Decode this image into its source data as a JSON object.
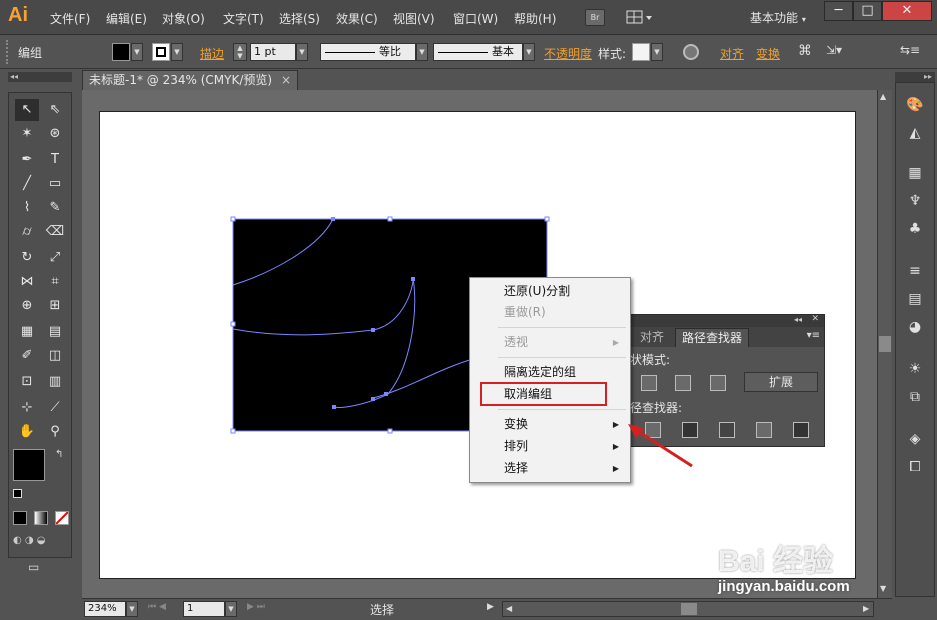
{
  "app": {
    "logo": "Ai",
    "workspace": "基本功能",
    "bridge_label": "Br"
  },
  "menubar": [
    "文件(F)",
    "编辑(E)",
    "对象(O)",
    "文字(T)",
    "选择(S)",
    "效果(C)",
    "视图(V)",
    "窗口(W)",
    "帮助(H)"
  ],
  "window_controls": {
    "minimize": "─",
    "maximize": "□",
    "close": "✕"
  },
  "control_bar": {
    "selection_label": "编组",
    "stroke_link": "描边",
    "stroke_weight": "1 pt",
    "stroke_profile": "等比",
    "brush_def": "基本",
    "opacity_link": "不透明度",
    "style_label": "样式:",
    "align_link": "对齐",
    "transform_link": "变换"
  },
  "document": {
    "tab_title": "未标题-1* @ 234% (CMYK/预览)",
    "close": "×"
  },
  "status_bar": {
    "zoom": "234%",
    "page": "1",
    "tool": "选择"
  },
  "context_menu": {
    "items": [
      {
        "label": "还原(U)分割",
        "disabled": false
      },
      {
        "label": "重做(R)",
        "disabled": true
      },
      {
        "label": "透视",
        "disabled": true,
        "submenu": true
      },
      {
        "label": "隔离选定的组",
        "disabled": false
      },
      {
        "label": "取消编组",
        "disabled": false,
        "highlighted": true
      },
      {
        "label": "变换",
        "disabled": false,
        "submenu": true
      },
      {
        "label": "排列",
        "disabled": false,
        "submenu": true
      },
      {
        "label": "选择",
        "disabled": false,
        "submenu": true
      }
    ]
  },
  "pathfinder_panel": {
    "tabs": [
      "对齐",
      "路径查找器"
    ],
    "active_tab": "路径查找器",
    "shape_modes_label": "形状模式:",
    "expand_button": "扩展",
    "pathfinders_label": "路径查找器:"
  },
  "watermark": {
    "brand": "Bai 经验",
    "url": "jingyan.baidu.com"
  },
  "colors": {
    "highlight_box": "#d42020",
    "path_stroke": "#7b86ff",
    "accent": "#f0a030"
  }
}
